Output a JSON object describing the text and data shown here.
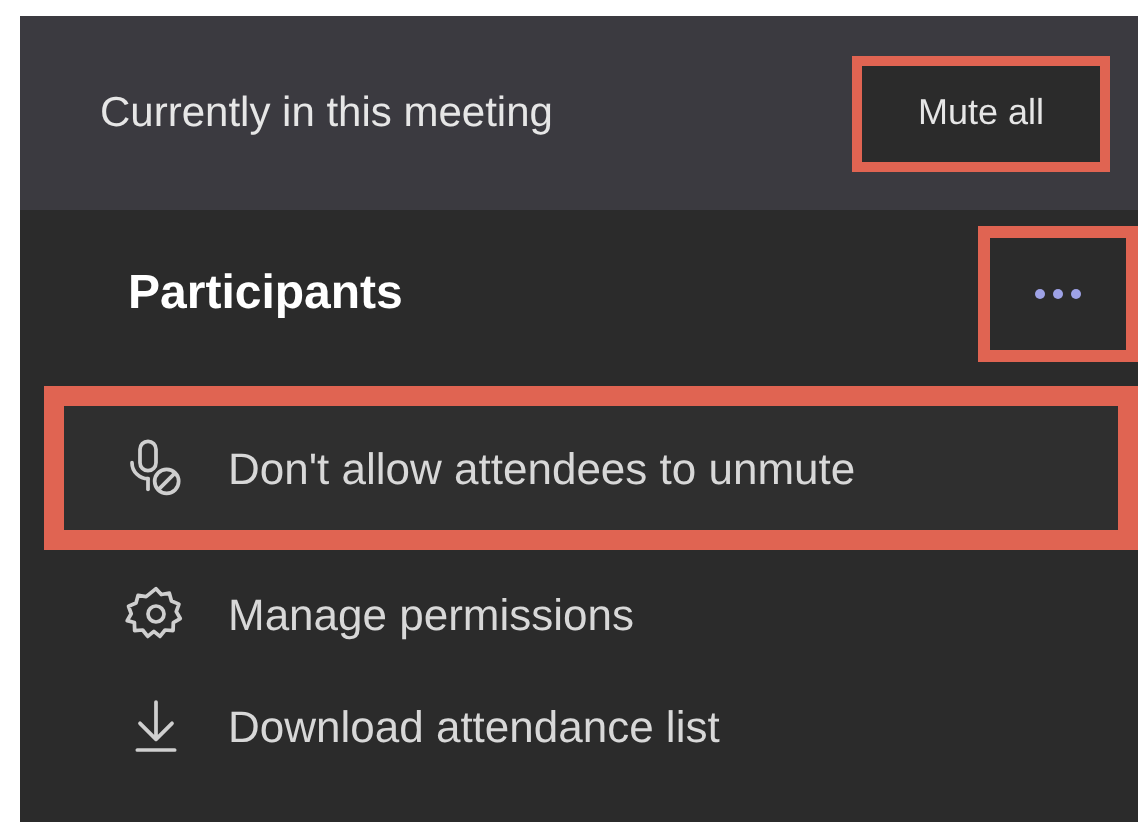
{
  "header": {
    "title": "Currently in this meeting",
    "mute_all_button": {
      "label": "Mute all",
      "highlighted": true
    }
  },
  "participants": {
    "title": "Participants",
    "more_button": {
      "highlighted": true
    }
  },
  "menu": [
    {
      "kind": "mic-off",
      "label": "Don't allow attendees to unmute",
      "highlighted": true
    },
    {
      "kind": "gear",
      "label": "Manage permissions",
      "highlighted": false
    },
    {
      "kind": "download",
      "label": "Download attendance list",
      "highlighted": false
    }
  ]
}
